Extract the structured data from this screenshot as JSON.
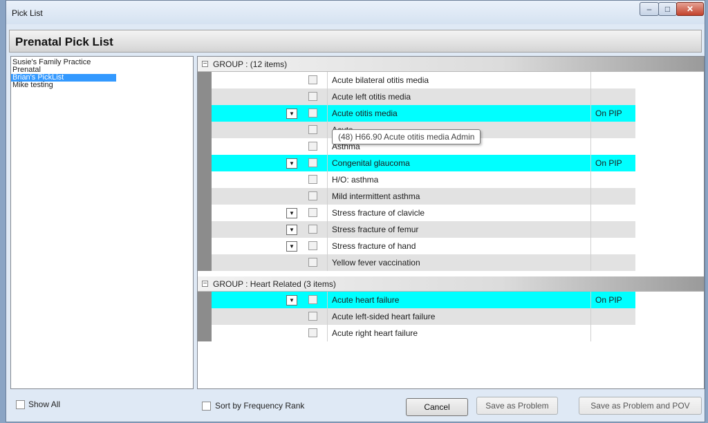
{
  "window": {
    "title": "Pick List"
  },
  "header": {
    "title": "Prenatal Pick List"
  },
  "left_list": {
    "items": [
      "Susie's Family Practice",
      "Prenatal",
      "Brian's PickList",
      "Mike testing"
    ],
    "selected_index": 2
  },
  "groups": [
    {
      "label": "GROUP :  (12 items)",
      "rows": [
        {
          "name": "Acute bilateral otitis media",
          "status": "",
          "dropdown": false,
          "highlight": false
        },
        {
          "name": "Acute left otitis media",
          "status": "",
          "dropdown": false,
          "highlight": false
        },
        {
          "name": "Acute otitis media",
          "status": "On PIP",
          "dropdown": true,
          "highlight": true
        },
        {
          "name": "Acute",
          "status": "",
          "dropdown": false,
          "highlight": false
        },
        {
          "name": "Asthma",
          "status": "",
          "dropdown": false,
          "highlight": false
        },
        {
          "name": "Congenital glaucoma",
          "status": "On PIP",
          "dropdown": true,
          "highlight": true
        },
        {
          "name": "H/O: asthma",
          "status": "",
          "dropdown": false,
          "highlight": false
        },
        {
          "name": "Mild intermittent asthma",
          "status": "",
          "dropdown": false,
          "highlight": false
        },
        {
          "name": "Stress fracture of clavicle",
          "status": "",
          "dropdown": true,
          "highlight": false
        },
        {
          "name": "Stress fracture of femur",
          "status": "",
          "dropdown": true,
          "highlight": false
        },
        {
          "name": "Stress fracture of hand",
          "status": "",
          "dropdown": true,
          "highlight": false
        },
        {
          "name": "Yellow fever vaccination",
          "status": "",
          "dropdown": false,
          "highlight": false
        }
      ]
    },
    {
      "label": "GROUP : Heart Related (3 items)",
      "rows": [
        {
          "name": "Acute heart failure",
          "status": "On PIP",
          "dropdown": true,
          "highlight": true
        },
        {
          "name": "Acute left-sided heart failure",
          "status": "",
          "dropdown": false,
          "highlight": false
        },
        {
          "name": "Acute right heart failure",
          "status": "",
          "dropdown": false,
          "highlight": false
        }
      ]
    }
  ],
  "tooltip": {
    "text": "(48) H66.90  Acute otitis media  Admin"
  },
  "footer": {
    "show_all": "Show All",
    "sort_by_frequency": "Sort by Frequency Rank",
    "cancel": "Cancel",
    "save_problem": "Save as Problem",
    "save_problem_pov": "Save as Problem and POV"
  },
  "colors": {
    "highlight": "#00ffff",
    "selection": "#3399ff",
    "alt_row": "#e2e2e2"
  }
}
